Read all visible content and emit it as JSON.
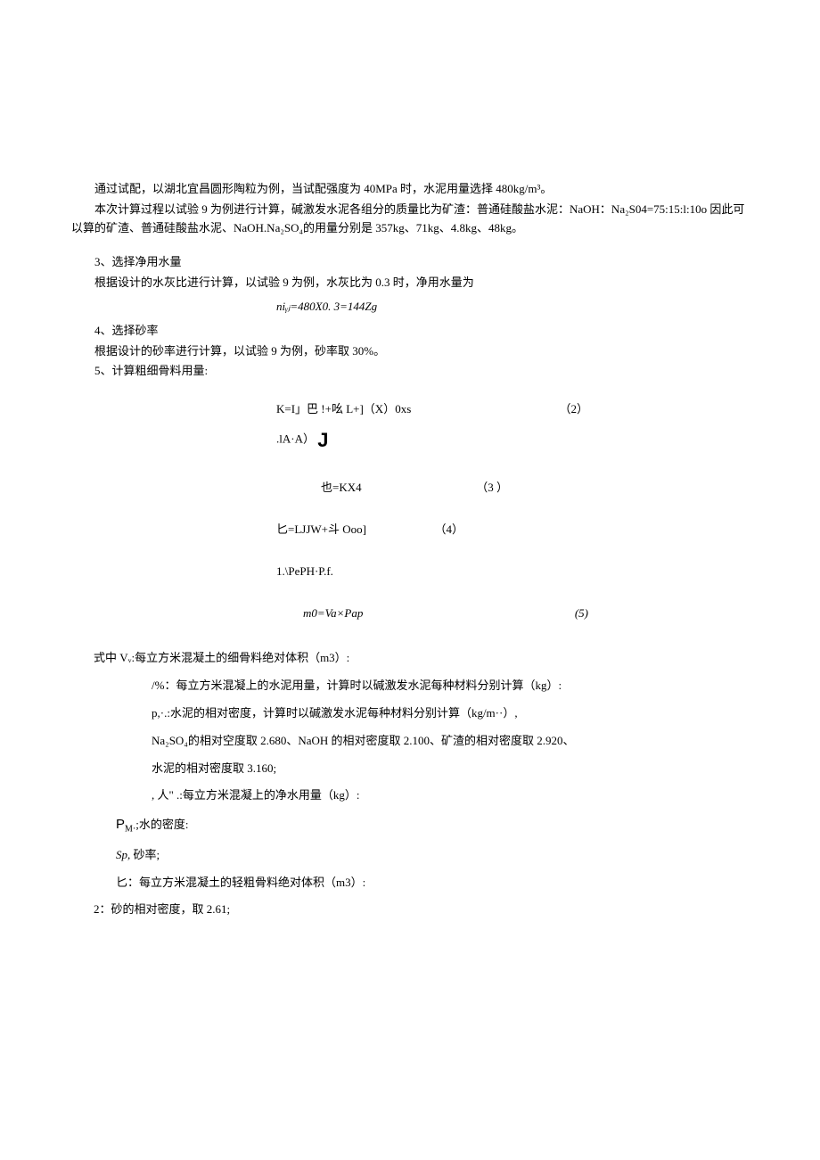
{
  "para1": "通过试配，以湖北宜昌圆形陶粒为例，当试配强度为 40MPa 时，水泥用量选择 480kg/m³。",
  "para2": "本次计算过程以试验 9 为例进行计算，碱激发水泥各组分的质量比为矿渣：普通硅酸盐水泥：NaOH：Na₂S04=75:15:l:10o 因此可以算的矿渣、普通硅酸盐水泥、NaOH.Na₂SO₄的用量分别是 357kg、71kg、4.8kg、48kg。",
  "sec3_title": "3、选择净用水量",
  "sec3_line": "根据设计的水灰比进行计算，以试验 9 为例，水灰比为 0.3 时，净用水量为",
  "eq1": "niᵧⱼ=480X0. 3=144Zg",
  "sec4_title": "4、选择砂率",
  "sec4_line": "根据设计的砂率进行计算，以试验 9 为例，砂率取 30%。",
  "sec5_title": "5、计算粗细骨料用量:",
  "eq2a": "K=I」巴 !+吆 L+]（X）0xs",
  "eq2b": ".lA·A）",
  "eq2num": "（2）",
  "eq3": "也=KX4",
  "eq3num": "（3 ）",
  "eq4": "匕=LJJW+斗 Ooo]",
  "eq4num": "（4）",
  "eq4b": "1.\\PePH·P.f.",
  "eq5": "m0=Va×Pap",
  "eq5num": "(5)",
  "def_intro": "式中 Vᵥ:每立方米混凝土的细骨料绝对体积（m3）:",
  "def1": "/%：每立方米混凝上的水泥用量，计算时以碱激发水泥每种材料分别计算（kg）:",
  "def2": "p,·.:水泥的相对密度，计算时以碱激发水泥每种材料分别计算（kg/m··）,",
  "def3": "Na₂SO₄的相对空度取 2.680、NaOH 的相对密度取 2.100、矿渣的相对密度取 2.920、",
  "def4": "水泥的相对密度取 3.160;",
  "def5": ", 人\" .:每立方米混凝上的净水用量（kg）:",
  "def6_prefix": "P",
  "def6_sub": "M·",
  "def6_rest": ";水的密度:",
  "def7_sym": "Sp,",
  "def7_rest": " 砂率;",
  "def8": "匕：每立方米混凝土的轻粗骨料绝对体积（m3）:",
  "def9": "2：砂的相对密度，取 2.61;"
}
